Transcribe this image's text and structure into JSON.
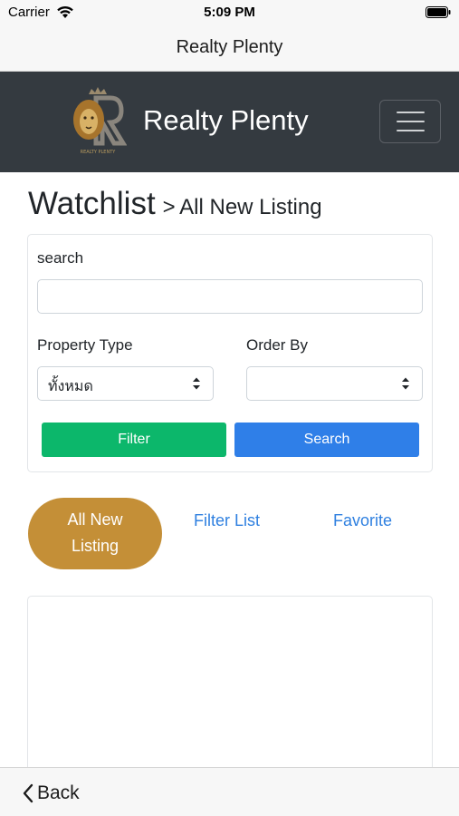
{
  "status_bar": {
    "carrier": "Carrier",
    "time": "5:09 PM"
  },
  "nav": {
    "title": "Realty Plenty"
  },
  "header": {
    "brand": "Realty Plenty",
    "logo_caption": "REALTY PLENTY"
  },
  "page": {
    "heading": "Watchlist",
    "separator": ">",
    "subheading": "All New Listing"
  },
  "filter": {
    "search_label": "search",
    "search_value": "",
    "property_type_label": "Property Type",
    "property_type_value": "ทั้งหมด",
    "order_by_label": "Order By",
    "order_by_value": "",
    "filter_button": "Filter",
    "search_button": "Search"
  },
  "tabs": {
    "all_new_line1": "All New",
    "all_new_line2": "Listing",
    "filter_list": "Filter List",
    "favorite": "Favorite"
  },
  "toolbar": {
    "back_label": "Back"
  },
  "colors": {
    "header_bg": "#343a40",
    "filter_green": "#0cb76b",
    "search_blue": "#2f7fe8",
    "tab_gold": "#c48f37",
    "link_blue": "#2f80e0"
  }
}
